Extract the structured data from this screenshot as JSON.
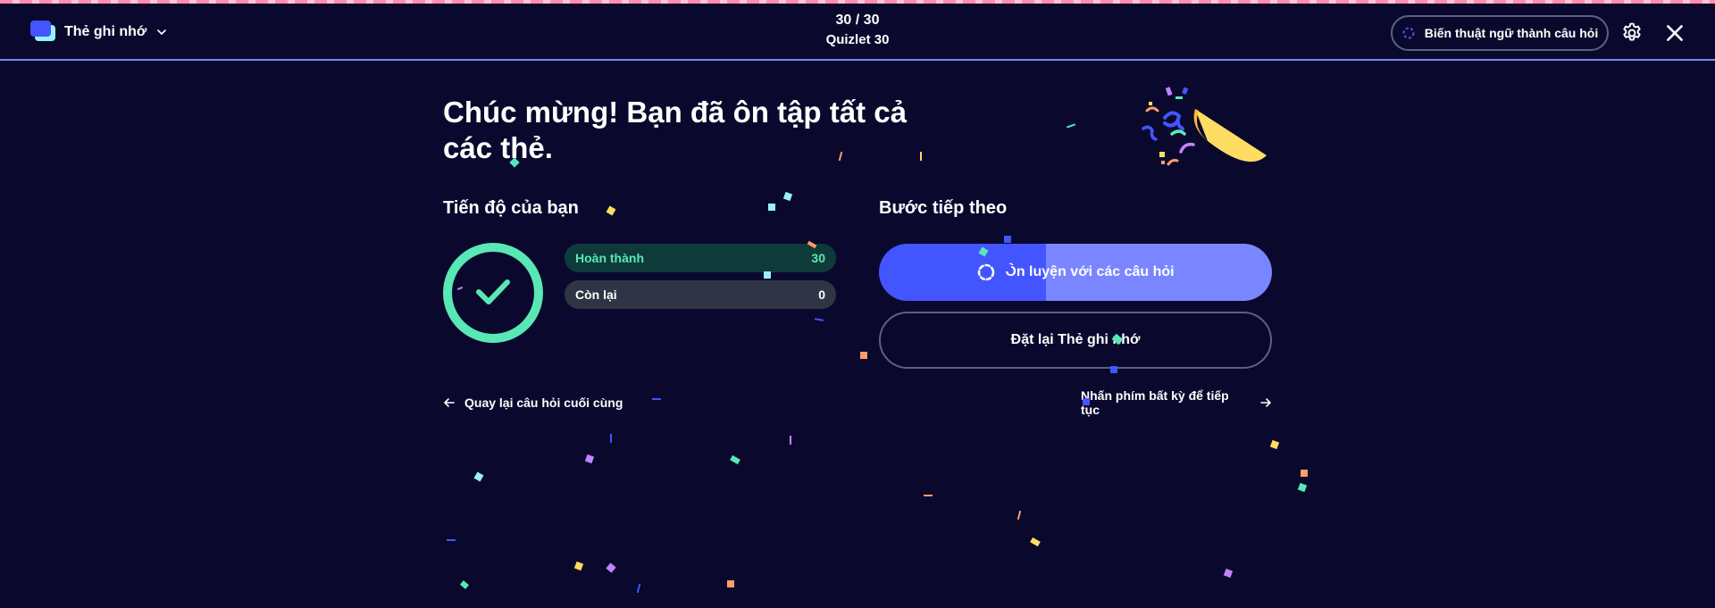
{
  "header": {
    "mode_label": "Thẻ ghi nhớ",
    "progress": "30 / 30",
    "set_title": "Quizlet 30",
    "convert_label": "Biến thuật ngữ thành câu hỏi"
  },
  "main": {
    "headline": "Chúc mừng! Bạn đã ôn tập tất cả các thẻ.",
    "progress_title": "Tiến độ của bạn",
    "next_title": "Bước tiếp theo",
    "stats": {
      "done_label": "Hoàn thành",
      "done_value": "30",
      "remaining_label": "Còn lại",
      "remaining_value": "0"
    },
    "practice_label": "Ôn luyện với các câu hỏi",
    "reset_label": "Đặt lại Thẻ ghi nhớ",
    "back_label": "Quay lại câu hỏi cuối cùng",
    "continue_label": "Nhấn phím bất kỳ để tiếp tục"
  },
  "colors": {
    "background": "#0a092d",
    "primary": "#4255ff",
    "primary_light": "#7a86ff",
    "success": "#59e8b5",
    "success_bg": "#0e3b3a",
    "neutral_bg": "#303545",
    "border": "#586380"
  },
  "icons": {
    "mode": "flashcards-icon",
    "chevron": "chevron-down-icon",
    "convert": "spinner-icon",
    "settings": "gear-icon",
    "close": "close-icon",
    "check": "check-icon",
    "practice": "spinner-icon",
    "back": "arrow-left-icon",
    "continue": "arrow-right-icon",
    "decoration": "party-popper-icon"
  }
}
